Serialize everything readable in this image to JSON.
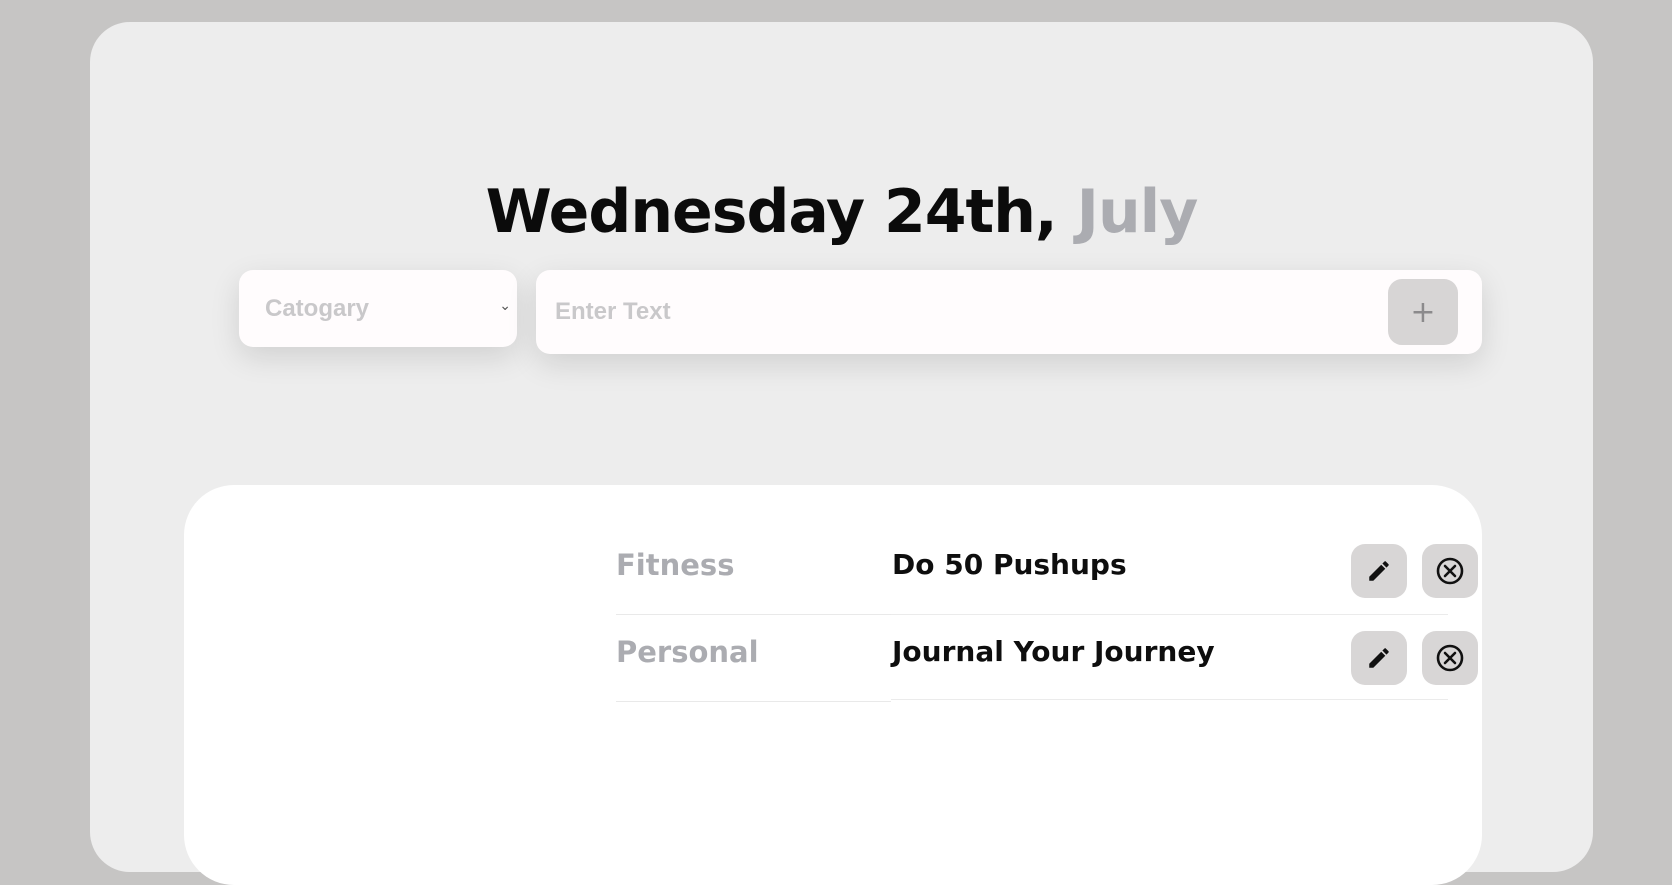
{
  "header": {
    "title_prefix": "Wednesday 24th,",
    "title_month": "July"
  },
  "form": {
    "category_placeholder": "Catogary",
    "category_chevron": "⌄",
    "text_placeholder": "Enter Text",
    "add_label": "+"
  },
  "tasks": [
    {
      "category": "Fitness",
      "text": "Do 50 Pushups",
      "edit_icon": "pencil-icon",
      "delete_icon": "circle-x-icon"
    },
    {
      "category": "Personal",
      "text": "Journal Your Journey",
      "edit_icon": "pencil-icon",
      "delete_icon": "circle-x-icon"
    }
  ],
  "colors": {
    "page_bg": "#c6c5c4",
    "card_bg": "#ededed",
    "accent_muted": "#abacb1",
    "button_bg": "#d8d6d6"
  }
}
